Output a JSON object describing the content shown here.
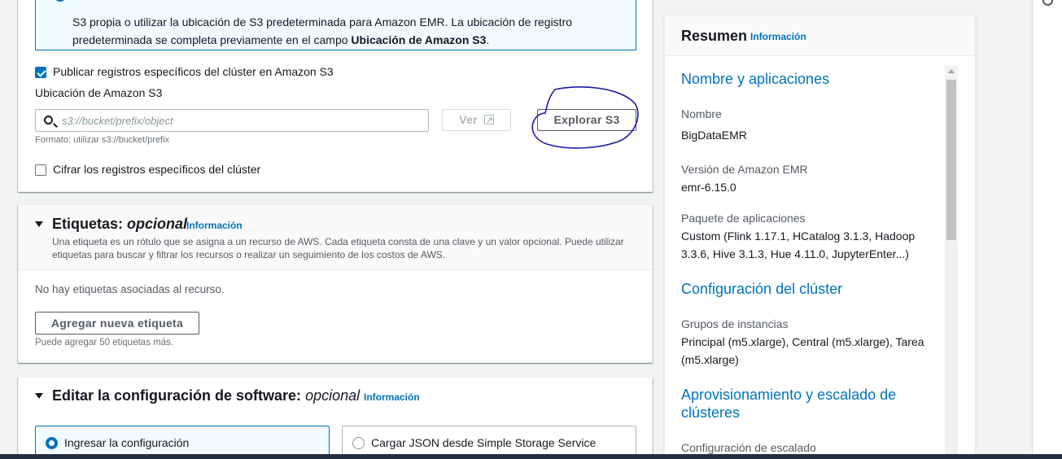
{
  "logging": {
    "info_line1": "S3 propia o utilizar la ubicación de S3 predeterminada para Amazon EMR. La ubicación de registro",
    "info_line2_prefix": "predeterminada se completa previamente en el campo ",
    "info_line2_bold": "Ubicación de Amazon S3",
    "info_line2_suffix": ".",
    "publish_checkbox_label": "Publicar registros específicos del clúster en Amazon S3",
    "publish_checked": true,
    "s3_location_label": "Ubicación de Amazon S3",
    "s3_input_placeholder": "s3://bucket/prefix/object",
    "view_button": "Ver",
    "browse_button": "Explorar S3",
    "format_hint": "Formato: utilizar s3://bucket/prefix",
    "encrypt_checkbox_label": "Cifrar los registros específicos del clúster",
    "encrypt_checked": false
  },
  "tags": {
    "title": "Etiquetas:",
    "title_optional": "opcional",
    "info_link": "Información",
    "description": "Una etiqueta es un rótulo que se asigna a un recurso de AWS. Cada etiqueta consta de una clave y un valor opcional. Puede utilizar etiquetas para buscar y filtrar los recursos o realizar un seguimiento de los costos de AWS.",
    "empty_text": "No hay etiquetas asociadas al recurso.",
    "add_button": "Agregar nueva etiqueta",
    "limit_hint": "Puede agregar 50 etiquetas más."
  },
  "software": {
    "title": "Editar la configuración de software:",
    "title_optional": "opcional",
    "info_link": "Información",
    "option_enter": "Ingresar la configuración",
    "option_load": "Cargar JSON desde Simple Storage Service",
    "selected": "option_enter"
  },
  "summary": {
    "title": "Resumen",
    "info_link": "Información",
    "section_names": "Nombre y aplicaciones",
    "name_label": "Nombre",
    "name_value": "BigDataEMR",
    "emr_version_label": "Versión de Amazon EMR",
    "emr_version_value": "emr-6.15.0",
    "app_bundle_label": "Paquete de aplicaciones",
    "app_bundle_value": "Custom (Flink 1.17.1, HCatalog 3.1.3, Hadoop 3.3.6, Hive 3.1.3, Hue 4.11.0, JupyterEnter...)",
    "section_cluster_config": "Configuración del clúster",
    "instance_groups_label": "Grupos de instancias",
    "instance_groups_value": "Principal (m5.xlarge), Central (m5.xlarge), Tarea (m5.xlarge)",
    "section_provisioning": "Aprovisionamiento y escalado de clústeres",
    "scaling_config_label": "Configuración de escalado"
  },
  "colors": {
    "accent": "#0073bb",
    "annotation": "#1a1aa6",
    "background": "#f2f3f3"
  }
}
